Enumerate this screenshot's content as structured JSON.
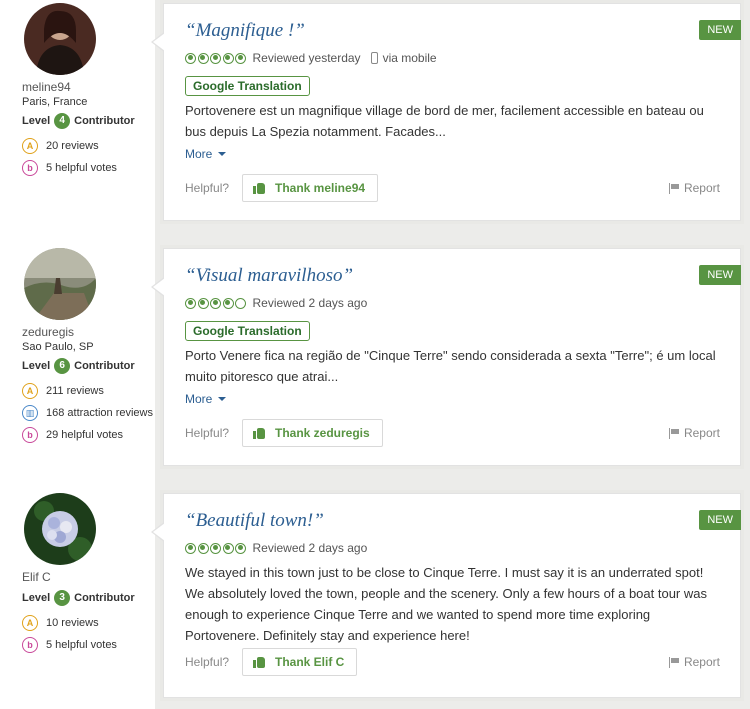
{
  "reviews": [
    {
      "member": {
        "username": "meline94",
        "location": "Paris, France",
        "level_prefix": "Level",
        "level": "4",
        "level_suffix": "Contributor",
        "badges": [
          {
            "icon": "reviews-icon",
            "text": "20 reviews"
          },
          {
            "icon": "helpful-votes-icon",
            "text": "5 helpful votes"
          }
        ]
      },
      "new_label": "NEW",
      "title": "“Magnifique !”",
      "rating_bubbles": 5,
      "reviewed": "Reviewed yesterday",
      "via": "via mobile",
      "translation_label": "Google Translation",
      "text": "Portovenere est un magnifique village de bord de mer, facilement accessible en bateau ou bus depuis La Spezia notamment. Facades...",
      "more_label": "More",
      "helpful_label": "Helpful?",
      "thank_label": "Thank meline94",
      "report_label": "Report"
    },
    {
      "member": {
        "username": "zeduregis",
        "location": "Sao Paulo, SP",
        "level_prefix": "Level",
        "level": "6",
        "level_suffix": "Contributor",
        "badges": [
          {
            "icon": "reviews-icon",
            "text": "211 reviews"
          },
          {
            "icon": "attraction-reviews-icon",
            "text": "168 attraction reviews"
          },
          {
            "icon": "helpful-votes-icon",
            "text": "29 helpful votes"
          }
        ]
      },
      "new_label": "NEW",
      "title": "“Visual maravilhoso”",
      "rating_bubbles": 4,
      "reviewed": "Reviewed 2 days ago",
      "translation_label": "Google Translation",
      "text": "Porto Venere fica na região de \"Cinque Terre\" sendo considerada a sexta \"Terre\"; é um local muito pitoresco que atrai...",
      "more_label": "More",
      "helpful_label": "Helpful?",
      "thank_label": "Thank zeduregis",
      "report_label": "Report"
    },
    {
      "member": {
        "username": "Elif C",
        "location": "",
        "level_prefix": "Level",
        "level": "3",
        "level_suffix": "Contributor",
        "badges": [
          {
            "icon": "reviews-icon",
            "text": "10 reviews"
          },
          {
            "icon": "helpful-votes-icon",
            "text": "5 helpful votes"
          }
        ]
      },
      "new_label": "NEW",
      "title": "“Beautiful town!”",
      "rating_bubbles": 5,
      "reviewed": "Reviewed 2 days ago",
      "text": "We stayed in this town just to be close to Cinque Terre. I must say it is an underrated spot! We absolutely loved the town, people and the scenery. Only a few hours of a boat tour was enough to experience Cinque Terre and we wanted to spend more time exploring Portovenere. Definitely stay and experience here!",
      "helpful_label": "Helpful?",
      "thank_label": "Thank Elif C",
      "report_label": "Report"
    }
  ],
  "colors": {
    "accent_green": "#589442",
    "title_blue": "#2c5e91",
    "background": "#ececea"
  }
}
